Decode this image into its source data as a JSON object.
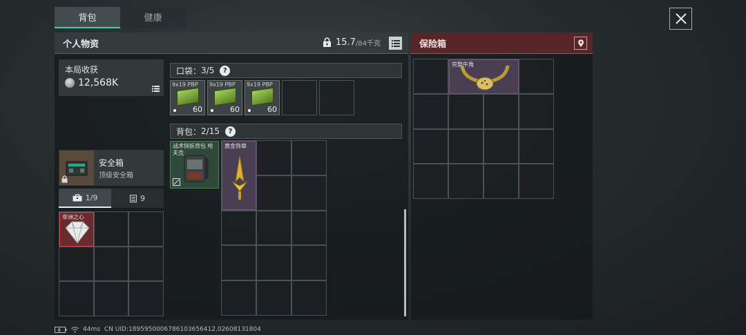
{
  "tabs": [
    {
      "label": "背包",
      "active": true
    },
    {
      "label": "健康",
      "active": false
    }
  ],
  "personal": {
    "title": "个人物资",
    "weight_current": "15.7",
    "weight_max": "/84千克"
  },
  "harvest": {
    "title": "本局收获",
    "value": "12,568K"
  },
  "secure_case": {
    "name": "安全箱",
    "subtitle": "顶级安全箱",
    "tab_slots": "1/9",
    "tab_count": "9"
  },
  "pocket": {
    "label": "口袋：",
    "count": "3/5",
    "help": "?",
    "ammo": [
      {
        "label": "9x19 PBP",
        "count": "60"
      },
      {
        "label": "9x19 PBP",
        "count": "60"
      },
      {
        "label": "9x19 PBP",
        "count": "60"
      }
    ]
  },
  "backpack": {
    "label": "背包：",
    "count": "2/15",
    "help": "?",
    "equipped_name": "战术快拆背包 哈夫克",
    "items": [
      {
        "name": "黄金饰章"
      }
    ]
  },
  "case_items": [
    {
      "name": "非洲之心"
    }
  ],
  "safe_box": {
    "title": "保险箱",
    "items": [
      {
        "name": "完整牛角"
      }
    ]
  },
  "status": {
    "ping": "44ms",
    "uid": "CN UID:1895950006786103656412,02608131804"
  },
  "colors": {
    "accent": "#3ad6a6",
    "safe_header": "#6e282c"
  },
  "icons": {
    "close": "close-icon",
    "lock": "lock-icon",
    "menu": "menu-icon",
    "pin": "location-pin-icon",
    "coin": "coin-icon",
    "briefcase": "briefcase-icon",
    "clipboard": "clipboard-icon"
  }
}
